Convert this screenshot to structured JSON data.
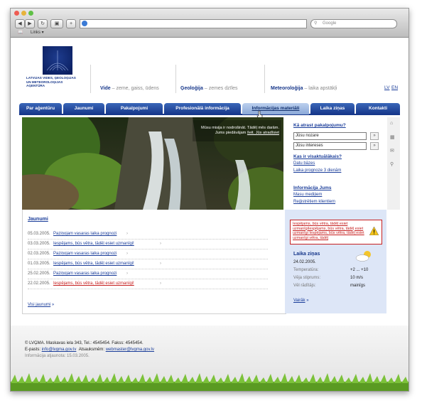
{
  "browser": {
    "search_placeholder": "Google",
    "bookmarks_label": "Links ▾"
  },
  "header": {
    "org_name": "LATVIJAS VIDES, ĢEOLOĢIJAS UN METEOROLOĢIJAS AĢENTŪRA",
    "sections": [
      {
        "title": "Vide",
        "desc": " – zeme, gaiss, ūdens"
      },
      {
        "title": "Ģeoloģija",
        "desc": " – zemes dzīles"
      },
      {
        "title": "Meteoroloģija",
        "desc": " – laika apstākļi"
      }
    ],
    "lang_lv": "LV",
    "lang_en": "EN"
  },
  "nav": [
    "Par aģentūru",
    "Jaunumi",
    "Pakalpojumi",
    "Profesionālā informācija",
    "Informācijas materiāli",
    "Laika ziņas",
    "Kontakti"
  ],
  "banner": {
    "text": "Mūsu misija ir nodrošināt. Tādēļ mēs darām. Jums piedāvājam",
    "link": "šeit. Jūs atradīsiet"
  },
  "side": {
    "find_title": "Kā atrast pakalpojumu?",
    "field1": "Jūsu nozare",
    "field2": "Jūsu intereses",
    "go": "»",
    "visited_title": "Kas ir visaktuālākais?",
    "visited_links": [
      "Datu bāzes",
      "Laika prognoze 3 dienām"
    ],
    "info_title": "Informācija Jums",
    "info_links": [
      "Masu medijiem",
      "Reģistrētiem klientiem"
    ]
  },
  "news": {
    "title": "Jaunumi",
    "items": [
      {
        "date": "05.03.2005.",
        "title": "Paziņojam vasaras laika prognozi",
        "red": false
      },
      {
        "date": "03.03.2005.",
        "title": "Iespējams, būs vētra, tādēļ esiet uzmanīgi!",
        "red": false
      },
      {
        "date": "02.03.2005.",
        "title": "Paziņojam vasaras laika prognozi",
        "red": false
      },
      {
        "date": "01.03.2005.",
        "title": "Iespējams, būs vētra, tādēļ esiet uzmanīgi!",
        "red": false
      },
      {
        "date": "25.02.2005.",
        "title": "Paziņojam vasaras laika prognozi",
        "red": false
      },
      {
        "date": "22.02.2005.",
        "title": "Iespējams, būs vētra, tādēļ esiet uzmanīgi!",
        "red": true
      }
    ],
    "all_link": "Visi jaunumi",
    "arrow": "»"
  },
  "warning": {
    "text": "Iespējams, būs vētra, tādēļ esiet uzmanīgiIespējams, būs vētra, tādēļ esiet uzmanīgi Iespējams, būs vētra, tādēļ esiet uzmanīgi vētra, tādēļ"
  },
  "weather": {
    "title": "Laika ziņas",
    "date": "24.02.2005.",
    "rows": [
      {
        "k": "Temperatūra:",
        "v": "+2 ... +10"
      },
      {
        "k": "Vēja stiprums:",
        "v": "10 m/s"
      },
      {
        "k": "Vēl rādītājs:",
        "v": "mainīgs"
      }
    ],
    "more": "Vairāk"
  },
  "footer": {
    "line1": "© LVĢMA. Maskavas iela 343, Tel.: 4545454. Fakss: 4545454.",
    "email_label": "E-pasts: ",
    "email": "info@lvgma.gov.lv",
    "webmaster_label": "Atsauksmēm: ",
    "webmaster": "webmaster@lvgma.gov.lv",
    "updated": "Informācija atjaunota: 15.03.2005."
  },
  "colors": {
    "brand": "#16368a",
    "accent": "#c62020",
    "panel": "#dde6f7"
  }
}
